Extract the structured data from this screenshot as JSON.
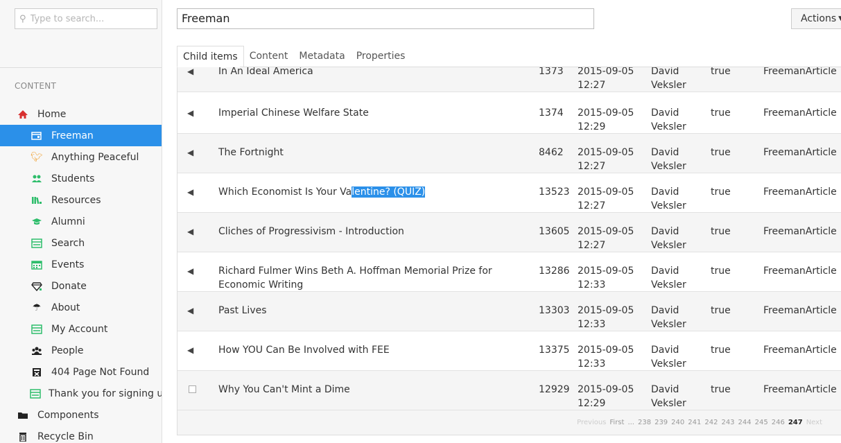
{
  "sidebar": {
    "search_placeholder": "Type to search...",
    "section_label": "CONTENT",
    "items": [
      {
        "label": "Home",
        "icon": "home-icon",
        "level": "root"
      },
      {
        "label": "Freeman",
        "icon": "layout-icon",
        "level": "child",
        "active": true
      },
      {
        "label": "Anything Peaceful",
        "icon": "bird-icon",
        "level": "child"
      },
      {
        "label": "Students",
        "icon": "people-icon",
        "level": "child"
      },
      {
        "label": "Resources",
        "icon": "books-icon",
        "level": "child"
      },
      {
        "label": "Alumni",
        "icon": "graduation-cap-icon",
        "level": "child"
      },
      {
        "label": "Search",
        "icon": "form-icon",
        "level": "child"
      },
      {
        "label": "Events",
        "icon": "calendar-icon",
        "level": "child"
      },
      {
        "label": "Donate",
        "icon": "diamond-icon",
        "level": "child"
      },
      {
        "label": "About",
        "icon": "umbrella-icon",
        "level": "child"
      },
      {
        "label": "My Account",
        "icon": "form-icon",
        "level": "child"
      },
      {
        "label": "People",
        "icon": "people-icon",
        "level": "child"
      },
      {
        "label": "404 Page Not Found",
        "icon": "error-page-icon",
        "level": "child"
      },
      {
        "label": "Thank you for signing up",
        "icon": "form-icon",
        "level": "child"
      },
      {
        "label": "Components",
        "icon": "folder-icon",
        "level": "root"
      },
      {
        "label": "Recycle Bin",
        "icon": "trash-icon",
        "level": "root"
      }
    ]
  },
  "header": {
    "search_value": "Freeman",
    "actions_label": "Actions"
  },
  "tabs": [
    "Child items",
    "Content",
    "Metadata",
    "Properties"
  ],
  "rows": [
    {
      "title": "In An Ideal America",
      "id": "1373",
      "date": "2015-09-05",
      "time": "12:27",
      "author_first": "David",
      "author_last": "Veksler",
      "published": "true",
      "type": "FreemanArticle",
      "icon": "share-icon"
    },
    {
      "title": "Imperial Chinese Welfare State",
      "id": "1374",
      "date": "2015-09-05",
      "time": "12:29",
      "author_first": "David",
      "author_last": "Veksler",
      "published": "true",
      "type": "FreemanArticle",
      "icon": "share-icon"
    },
    {
      "title": "The Fortnight",
      "id": "8462",
      "date": "2015-09-05",
      "time": "12:27",
      "author_first": "David",
      "author_last": "Veksler",
      "published": "true",
      "type": "FreemanArticle",
      "icon": "share-icon"
    },
    {
      "title_pre": "Which Economist Is Your Va",
      "title_sel": "lentine? (QUIZ)",
      "id": "13523",
      "date": "2015-09-05",
      "time": "12:27",
      "author_first": "David",
      "author_last": "Veksler",
      "published": "true",
      "type": "FreemanArticle",
      "icon": "share-icon"
    },
    {
      "title": "Cliches of Progressivism - Introduction",
      "id": "13605",
      "date": "2015-09-05",
      "time": "12:27",
      "author_first": "David",
      "author_last": "Veksler",
      "published": "true",
      "type": "FreemanArticle",
      "icon": "share-icon"
    },
    {
      "title": "Richard Fulmer Wins Beth A. Hoffman Memorial Prize for Economic Writing",
      "id": "13286",
      "date": "2015-09-05",
      "time": "12:33",
      "author_first": "David",
      "author_last": "Veksler",
      "published": "true",
      "type": "FreemanArticle",
      "icon": "share-icon"
    },
    {
      "title": "Past Lives",
      "id": "13303",
      "date": "2015-09-05",
      "time": "12:33",
      "author_first": "David",
      "author_last": "Veksler",
      "published": "true",
      "type": "FreemanArticle",
      "icon": "share-icon"
    },
    {
      "title": "How YOU Can Be Involved with FEE",
      "id": "13375",
      "date": "2015-09-05",
      "time": "12:33",
      "author_first": "David",
      "author_last": "Veksler",
      "published": "true",
      "type": "FreemanArticle",
      "icon": "share-icon"
    },
    {
      "title": "Why You Can't Mint a Dime",
      "id": "12929",
      "date": "2015-09-05",
      "time": "12:29",
      "author_first": "David",
      "author_last": "Veksler",
      "published": "true",
      "type": "FreemanArticle",
      "icon": "checkbox"
    }
  ],
  "pager": {
    "previous": "Previous",
    "first": "First",
    "ellipsis": "...",
    "pages": [
      "238",
      "239",
      "240",
      "241",
      "242",
      "243",
      "244",
      "245",
      "246",
      "247"
    ],
    "current": "247",
    "next": "Next"
  },
  "colors": {
    "accent": "#2b90e9",
    "green_icon": "#2ebd6b",
    "home_icon": "#d83030"
  }
}
